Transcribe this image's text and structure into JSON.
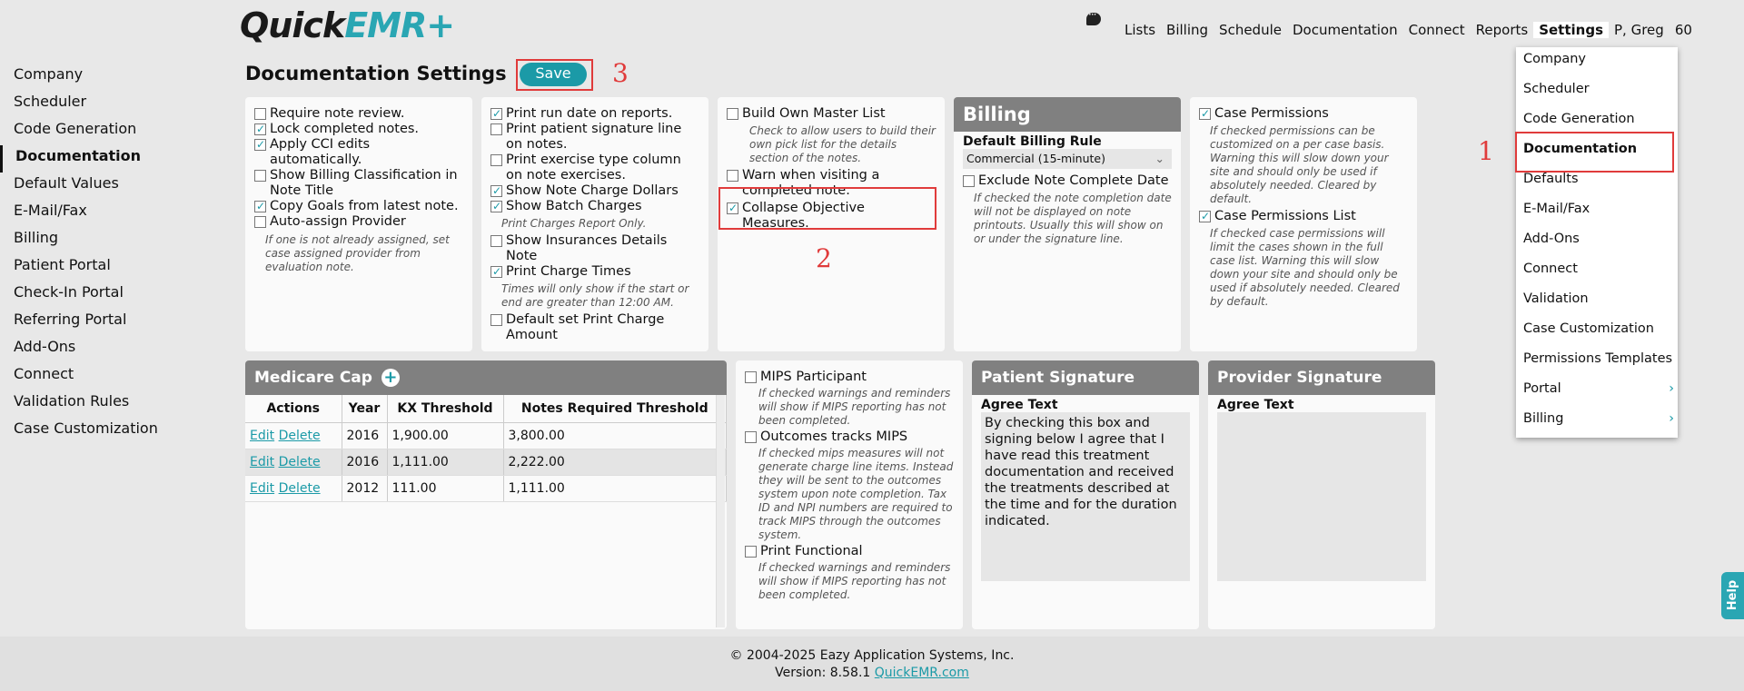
{
  "logo": {
    "part1": "Quick",
    "part2": "EMR",
    "plus": "+"
  },
  "nav": {
    "items": [
      "Lists",
      "Billing",
      "Schedule",
      "Documentation",
      "Connect",
      "Reports",
      "Settings",
      "P, Greg",
      "60"
    ],
    "active": "Settings"
  },
  "sidebar": {
    "items": [
      "Company",
      "Scheduler",
      "Code Generation",
      "Documentation",
      "Default Values",
      "E-Mail/Fax",
      "Billing",
      "Patient Portal",
      "Check-In Portal",
      "Referring Portal",
      "Add-Ons",
      "Connect",
      "Validation Rules",
      "Case Customization"
    ],
    "selected": "Documentation"
  },
  "page": {
    "title": "Documentation Settings",
    "save_label": "Save"
  },
  "annotations": {
    "n1": "1",
    "n2": "2",
    "n3": "3"
  },
  "col1": {
    "opts": [
      {
        "label": "Require note review.",
        "checked": false
      },
      {
        "label": "Lock completed notes.",
        "checked": true
      },
      {
        "label": "Apply CCI edits automatically.",
        "checked": true
      },
      {
        "label": "Show Billing Classification in Note Title",
        "checked": false
      },
      {
        "label": "Copy Goals from latest note.",
        "checked": true
      },
      {
        "label": "Auto-assign Provider",
        "checked": false
      }
    ],
    "hint": "If one is not already assigned, set case assigned provider from evaluation note."
  },
  "col2": {
    "opts": [
      {
        "label": "Print run date on reports.",
        "checked": true
      },
      {
        "label": "Print patient signature line on notes.",
        "checked": false
      },
      {
        "label": "Print exercise type column on note exercises.",
        "checked": false
      },
      {
        "label": "Show Note Charge Dollars",
        "checked": true
      },
      {
        "label": "Show Batch Charges",
        "checked": true
      },
      {
        "label": "Show Insurances Details Note",
        "checked": false
      },
      {
        "label": "Print Charge Times",
        "checked": true
      },
      {
        "label": "Default set Print Charge Amount",
        "checked": false
      }
    ],
    "hint_batch": "Print Charges Report Only.",
    "hint_times": "Times will only show if the start or end are greater than 12:00 AM."
  },
  "col3": {
    "opts": [
      {
        "label": "Build Own Master List",
        "checked": false
      },
      {
        "label": "Warn when visiting a completed note.",
        "checked": false
      },
      {
        "label": "Collapse Objective Measures.",
        "checked": true
      }
    ],
    "hint": "Check to allow users to build their own pick list for the details section of the notes."
  },
  "billing": {
    "title": "Billing",
    "rule_label": "Default Billing Rule",
    "rule_value": "Commercial (15-minute)",
    "exclude_label": "Exclude Note Complete Date",
    "exclude_hint": "If checked the note completion date will not be displayed on note printouts. Usually this will show on or under the signature line."
  },
  "col5": {
    "opt1": "Case Permissions",
    "hint1": "If checked permissions can be customized on a per case basis. Warning this will slow down your site and should only be used if absolutely needed. Cleared by default.",
    "opt2": "Case Permissions List",
    "hint2": "If checked case permissions will limit the cases shown in the full case list. Warning this will slow down your site and should only be used if absolutely needed. Cleared by default."
  },
  "medicare": {
    "title": "Medicare Cap",
    "headers": [
      "Actions",
      "Year",
      "KX Threshold",
      "Notes Required Threshold"
    ],
    "edit": "Edit",
    "delete": "Delete",
    "rows": [
      {
        "year": "2016",
        "kx": "1,900.00",
        "notes": "3,800.00"
      },
      {
        "year": "2016",
        "kx": "1,111.00",
        "notes": "2,222.00"
      },
      {
        "year": "2012",
        "kx": "111.00",
        "notes": "1,111.00"
      }
    ]
  },
  "mips": {
    "opt1": "MIPS Participant",
    "hint1": "If checked warnings and reminders will show if MIPS reporting has not been completed.",
    "opt2": "Outcomes tracks MIPS",
    "hint2": "If checked mips measures will not generate charge line items. Instead they will be sent to the outcomes system upon note completion. Tax ID and NPI numbers are required to track MIPS through the outcomes system.",
    "opt3": "Print Functional",
    "hint3": "If checked warnings and reminders will show if MIPS reporting has not been completed."
  },
  "patient_sig": {
    "title": "Patient Signature",
    "label": "Agree Text",
    "text": "By checking this box and signing below I agree that I have read this treatment documentation and received the treatments described at the time and for the duration indicated."
  },
  "provider_sig": {
    "title": "Provider Signature",
    "label": "Agree Text",
    "text": ""
  },
  "dropdown": {
    "items": [
      "Company",
      "Scheduler",
      "Code Generation",
      "Documentation",
      "Defaults",
      "E-Mail/Fax",
      "Add-Ons",
      "Connect",
      "Validation",
      "Case Customization",
      "Permissions Templates",
      "Portal",
      "Billing"
    ],
    "selected": "Documentation"
  },
  "footer": {
    "copyright": "© 2004-2025 Eazy Application Systems, Inc.",
    "version_prefix": "Version: 8.58.1",
    "link": "QuickEMR.com"
  },
  "help": {
    "label": "Help"
  },
  "colors": {
    "accent": "#1b9aa7",
    "annotation": "#e03b3b",
    "header_gray": "#808080"
  }
}
